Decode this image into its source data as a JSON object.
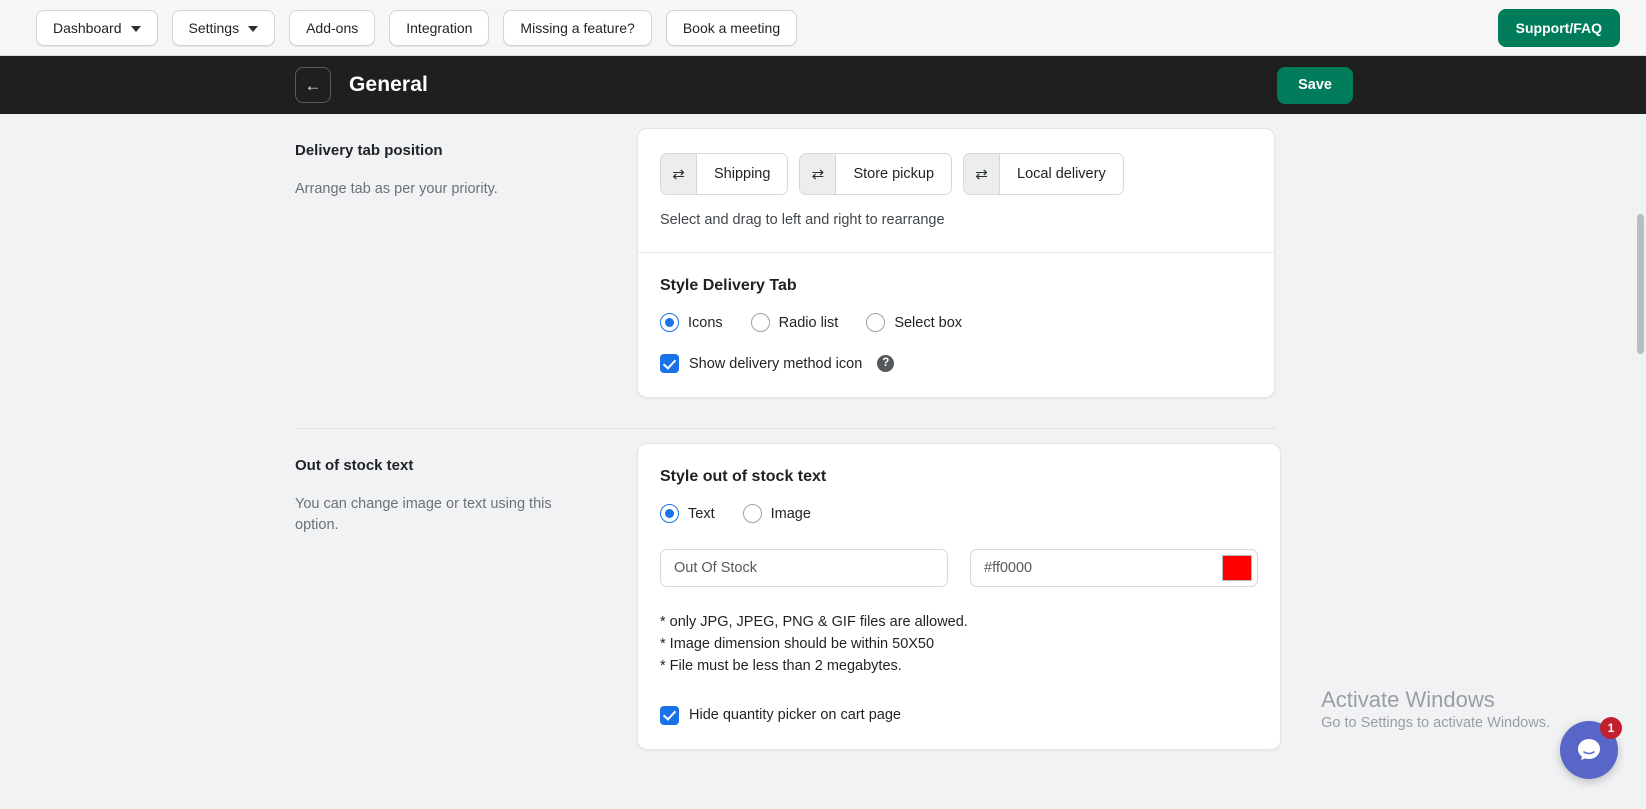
{
  "topnav": {
    "items": [
      {
        "label": "Dashboard",
        "has_caret": true,
        "name": "nav-dashboard"
      },
      {
        "label": "Settings",
        "has_caret": true,
        "name": "nav-settings"
      },
      {
        "label": "Add-ons",
        "has_caret": false,
        "name": "nav-add-ons"
      },
      {
        "label": "Integration",
        "has_caret": false,
        "name": "nav-integration"
      },
      {
        "label": "Missing a feature?",
        "has_caret": false,
        "name": "nav-missing-feature"
      },
      {
        "label": "Book a meeting",
        "has_caret": false,
        "name": "nav-book-meeting"
      }
    ],
    "support_label": "Support/FAQ",
    "brand_green": "#007c5a"
  },
  "header": {
    "back_icon": "←",
    "title": "General",
    "save_label": "Save",
    "background": "#1f1f1f"
  },
  "sections": [
    {
      "heading": "Delivery tab position",
      "description": "Arrange tab as per your priority.",
      "tabs": [
        {
          "label": "Shipping",
          "grip_icon": "⇄"
        },
        {
          "label": "Store pickup",
          "grip_icon": "⇄"
        },
        {
          "label": "Local delivery",
          "grip_icon": "⇄"
        }
      ],
      "hint": "Select and drag to left and right to rearrange",
      "style_block": {
        "title": "Style Delivery Tab",
        "options": [
          {
            "label": "Icons",
            "selected": true
          },
          {
            "label": "Radio list",
            "selected": false
          },
          {
            "label": "Select box",
            "selected": false
          }
        ],
        "checkbox_label": "Show delivery method icon",
        "checkbox_checked": true,
        "help_icon": "?"
      }
    },
    {
      "heading": "Out of stock text",
      "description": "You can change image or text using this option.",
      "block_title": "Style out of stock text",
      "options": [
        {
          "label": "Text",
          "selected": true
        },
        {
          "label": "Image",
          "selected": false
        }
      ],
      "text_value": "Out Of Stock",
      "color_value": "#ff0000",
      "swatch_color": "#ff0000",
      "notes": [
        "* only JPG, JPEG, PNG & GIF files are allowed.",
        "* Image dimension should be within 50X50",
        "* File must be less than 2 megabytes."
      ],
      "checkbox_label": "Hide quantity picker on cart page",
      "checkbox_checked": true
    }
  ],
  "watermark": {
    "line1": "Activate Windows",
    "line2": "Go to Settings to activate Windows."
  },
  "chat": {
    "badge_count": "1",
    "icon": "chat-bubble"
  },
  "radio_accent": "#1a72e8"
}
